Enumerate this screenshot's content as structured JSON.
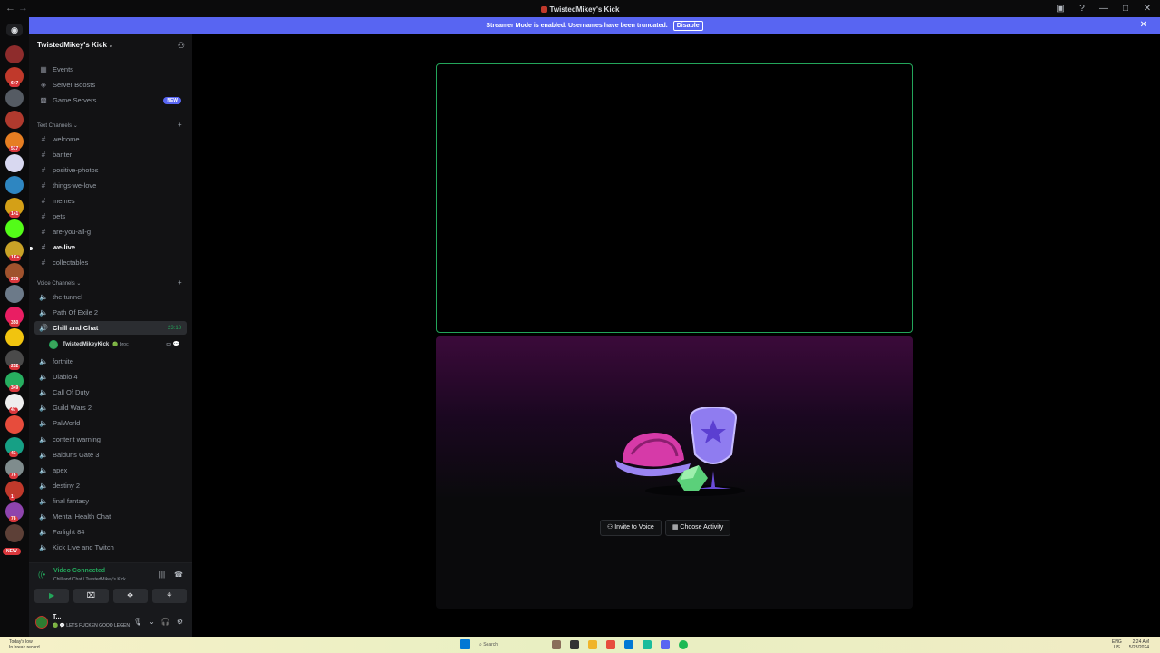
{
  "window": {
    "title": "TwistedMikey's Kick",
    "back": "←",
    "forward": "→",
    "buttons": [
      "▣",
      "?",
      "—",
      "□",
      "✕"
    ]
  },
  "banner": {
    "text": "Streamer Mode is enabled. Usernames have been truncated.",
    "disable_label": "Disable",
    "close": "✕"
  },
  "rail": {
    "discord_glyph": "◉",
    "servers": [
      {
        "color": "#8e2c2c",
        "badge": ""
      },
      {
        "color": "#c0392b",
        "badge": "647"
      },
      {
        "color": "#555b63",
        "badge": ""
      },
      {
        "color": "#b03a2e",
        "badge": ""
      },
      {
        "color": "#e67e22",
        "badge": "517"
      },
      {
        "color": "#d8d8f0",
        "badge": ""
      },
      {
        "color": "#2e86c1",
        "badge": ""
      },
      {
        "color": "#d4a017",
        "badge": "141"
      },
      {
        "color": "#53fc18",
        "badge": ""
      },
      {
        "color": "#c9a227",
        "badge": "1K+"
      },
      {
        "color": "#a0522d",
        "badge": "235"
      },
      {
        "color": "#6c7a89",
        "badge": ""
      },
      {
        "color": "#e91e63",
        "badge": "350"
      },
      {
        "color": "#f1c40f",
        "badge": ""
      },
      {
        "color": "#4a4a4a",
        "badge": "252"
      },
      {
        "color": "#27ae60",
        "badge": "349"
      },
      {
        "color": "#eeeeee",
        "badge": "47"
      },
      {
        "color": "#e74c3c",
        "badge": ""
      },
      {
        "color": "#16a085",
        "badge": "41"
      },
      {
        "color": "#7f8c8d",
        "badge": "76"
      },
      {
        "color": "#c0392b",
        "badge": "1"
      },
      {
        "color": "#8e44ad",
        "badge": "78"
      },
      {
        "color": "#5d4037",
        "badge": ""
      }
    ],
    "new_label": "NEW"
  },
  "server": {
    "name": "TwistedMikey's Kick",
    "chevron": "⌄",
    "invite_icon": "⚇"
  },
  "nav": [
    {
      "icon": "▦",
      "label": "Events"
    },
    {
      "icon": "◈",
      "label": "Server Boosts"
    },
    {
      "icon": "▩",
      "label": "Game Servers",
      "pill": "NEW"
    }
  ],
  "text_category": {
    "label": "Text Channels",
    "chevron": "⌄",
    "plus": "+"
  },
  "text_channels": [
    {
      "label": "welcome",
      "bold": false
    },
    {
      "label": "banter",
      "bold": false
    },
    {
      "label": "positive-photos",
      "bold": false
    },
    {
      "label": "things-we-love",
      "bold": false
    },
    {
      "label": "memes",
      "bold": false
    },
    {
      "label": "pets",
      "bold": false
    },
    {
      "label": "are-you-all-g",
      "bold": false
    },
    {
      "label": "we-live",
      "bold": true
    },
    {
      "label": "collectables",
      "bold": false
    }
  ],
  "voice_category": {
    "label": "Voice Channels",
    "chevron": "⌄",
    "plus": "+"
  },
  "voice_channels_top": [
    {
      "label": "the tunnel"
    },
    {
      "label": "Path Of Exile 2"
    }
  ],
  "active_voice": {
    "label": "Chill and Chat",
    "time": "23:18"
  },
  "member": {
    "name": "TwistedMikeyKick",
    "tag": "🟢 broc",
    "icons": "▭ 💬"
  },
  "voice_channels_bottom": [
    {
      "label": "fortnite"
    },
    {
      "label": "Diablo 4"
    },
    {
      "label": "Call Of Duty"
    },
    {
      "label": "Guild Wars 2"
    },
    {
      "label": "PalWorld"
    },
    {
      "label": "content warning"
    },
    {
      "label": "Baldur's Gate 3"
    },
    {
      "label": "apex"
    },
    {
      "label": "destiny 2"
    },
    {
      "label": "final fantasy"
    },
    {
      "label": "Mental Health Chat"
    },
    {
      "label": "Farlight 84"
    },
    {
      "label": "Kick Live and Twitch"
    }
  ],
  "voice_panel": {
    "title": "Video Connected",
    "subtitle": "Chill and Chat / TwistedMikey's Kick",
    "signal_icon": "((•",
    "noise_icon": "|||",
    "disconnect_icon": "☎",
    "buttons": [
      "▶",
      "⌧",
      "✥",
      "⚘"
    ]
  },
  "user": {
    "name": "T...",
    "status": "🟢 💬 LETS FUCKEN GOOO LEGEN",
    "mic": "🎙",
    "headset": "🎧",
    "settings": "⚙",
    "chev": "⌄"
  },
  "activity": {
    "invite_label": "Invite to Voice",
    "choose_label": "Choose Activity",
    "invite_icon": "⚇",
    "choose_icon": "▦"
  },
  "taskbar": {
    "weather_line1": "Today's low",
    "weather_line2": "In break record",
    "search": "Search",
    "lang1": "ENG",
    "lang2": "US",
    "time": "2:24 AM",
    "date": "5/23/2024"
  }
}
